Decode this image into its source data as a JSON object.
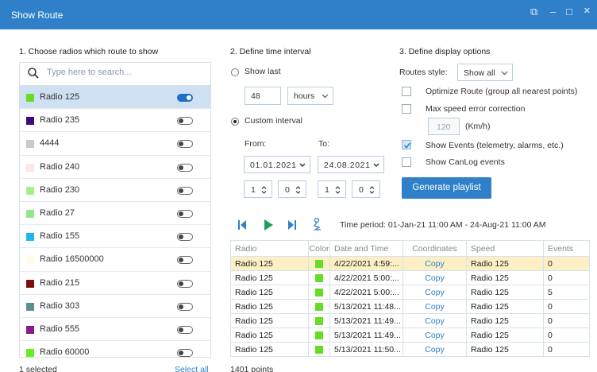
{
  "window": {
    "title": "Show Route",
    "controls": {
      "open_external": "⧉",
      "minimize": "–",
      "maximize": "□",
      "close": "×"
    }
  },
  "section1": {
    "title": "1. Choose radios which route to show",
    "search_placeholder": "Type here to search...",
    "radios": [
      {
        "name": "Radio 125",
        "color": "#66dd22",
        "on": true,
        "selected": true
      },
      {
        "name": "Radio 235",
        "color": "#3d0c7a",
        "on": false,
        "selected": false
      },
      {
        "name": "4444",
        "color": "#c8c8c8",
        "on": false,
        "selected": false
      },
      {
        "name": "Radio 240",
        "color": "#fde6e6",
        "on": false,
        "selected": false
      },
      {
        "name": "Radio 230",
        "color": "#a3f089",
        "on": false,
        "selected": false
      },
      {
        "name": "Radio 27",
        "color": "#93e48f",
        "on": false,
        "selected": false
      },
      {
        "name": "Radio 155",
        "color": "#1eb4f0",
        "on": false,
        "selected": false
      },
      {
        "name": "Radio 16500000",
        "color": "#fdfde6",
        "on": false,
        "selected": false
      },
      {
        "name": "Radio 215",
        "color": "#7a0e0e",
        "on": false,
        "selected": false
      },
      {
        "name": "Radio 303",
        "color": "#5b8f8f",
        "on": false,
        "selected": false
      },
      {
        "name": "Radio 555",
        "color": "#8a1a8a",
        "on": false,
        "selected": false
      },
      {
        "name": "Radio 60000",
        "color": "#66ee22",
        "on": false,
        "selected": false
      }
    ],
    "selected_count": "1 selected",
    "select_all": "Select all"
  },
  "section2": {
    "title": "2. Define time interval",
    "show_last_label": "Show last",
    "show_last_value": "48",
    "show_last_unit": "hours",
    "custom_label": "Custom interval",
    "from_label": "From:",
    "to_label": "To:",
    "from_date": "01.01.2021",
    "to_date": "24.08.2021",
    "from_hour": "1",
    "from_min": "0",
    "to_hour": "1",
    "to_min": "0"
  },
  "section3": {
    "title": "3. Define display options",
    "routes_style_label": "Routes style:",
    "routes_style_value": "Show all",
    "optimize_label": "Optimize Route (group all nearest points)",
    "max_speed_label": "Max speed error correction",
    "max_speed_value": "120",
    "max_speed_unit": "(Km/h)",
    "show_events_label": "Show Events (telemetry, alarms, etc.)",
    "show_canlog_label": "Show CanLog events",
    "generate_button": "Generate playlist"
  },
  "playback": {
    "time_period": "Time period: 01-Jan-21 11:00 AM - 24-Aug-21 11:00 AM"
  },
  "table": {
    "headers": [
      "Radio",
      "Color",
      "Date and Time",
      "Coordinates",
      "Speed",
      "Events"
    ],
    "rows": [
      {
        "radio": "Radio 125",
        "color": "#66dd22",
        "datetime": "4/22/2021 4:59:...",
        "coord": "Copy",
        "speed": "Radio 125",
        "events": "0",
        "highlight": true
      },
      {
        "radio": "Radio 125",
        "color": "#66dd22",
        "datetime": "4/22/2021 5:00:...",
        "coord": "Copy",
        "speed": "Radio 125",
        "events": "0",
        "highlight": false
      },
      {
        "radio": "Radio 125",
        "color": "#66dd22",
        "datetime": "4/22/2021 5:00:...",
        "coord": "Copy",
        "speed": "Radio 125",
        "events": "5",
        "highlight": false
      },
      {
        "radio": "Radio 125",
        "color": "#66dd22",
        "datetime": "5/13/2021 11:48...",
        "coord": "Copy",
        "speed": "Radio 125",
        "events": "0",
        "highlight": false
      },
      {
        "radio": "Radio 125",
        "color": "#66dd22",
        "datetime": "5/13/2021 11:49...",
        "coord": "Copy",
        "speed": "Radio 125",
        "events": "0",
        "highlight": false
      },
      {
        "radio": "Radio 125",
        "color": "#66dd22",
        "datetime": "5/13/2021 11:49...",
        "coord": "Copy",
        "speed": "Radio 125",
        "events": "0",
        "highlight": false
      },
      {
        "radio": "Radio 125",
        "color": "#66dd22",
        "datetime": "5/13/2021 11:50...",
        "coord": "Copy",
        "speed": "Radio 125",
        "events": "0",
        "highlight": false
      }
    ],
    "points": "1401  points"
  },
  "colors": {
    "accent": "#2f80c9",
    "selected_row": "#cfe0f3",
    "highlight_row": "#fcefc6"
  }
}
